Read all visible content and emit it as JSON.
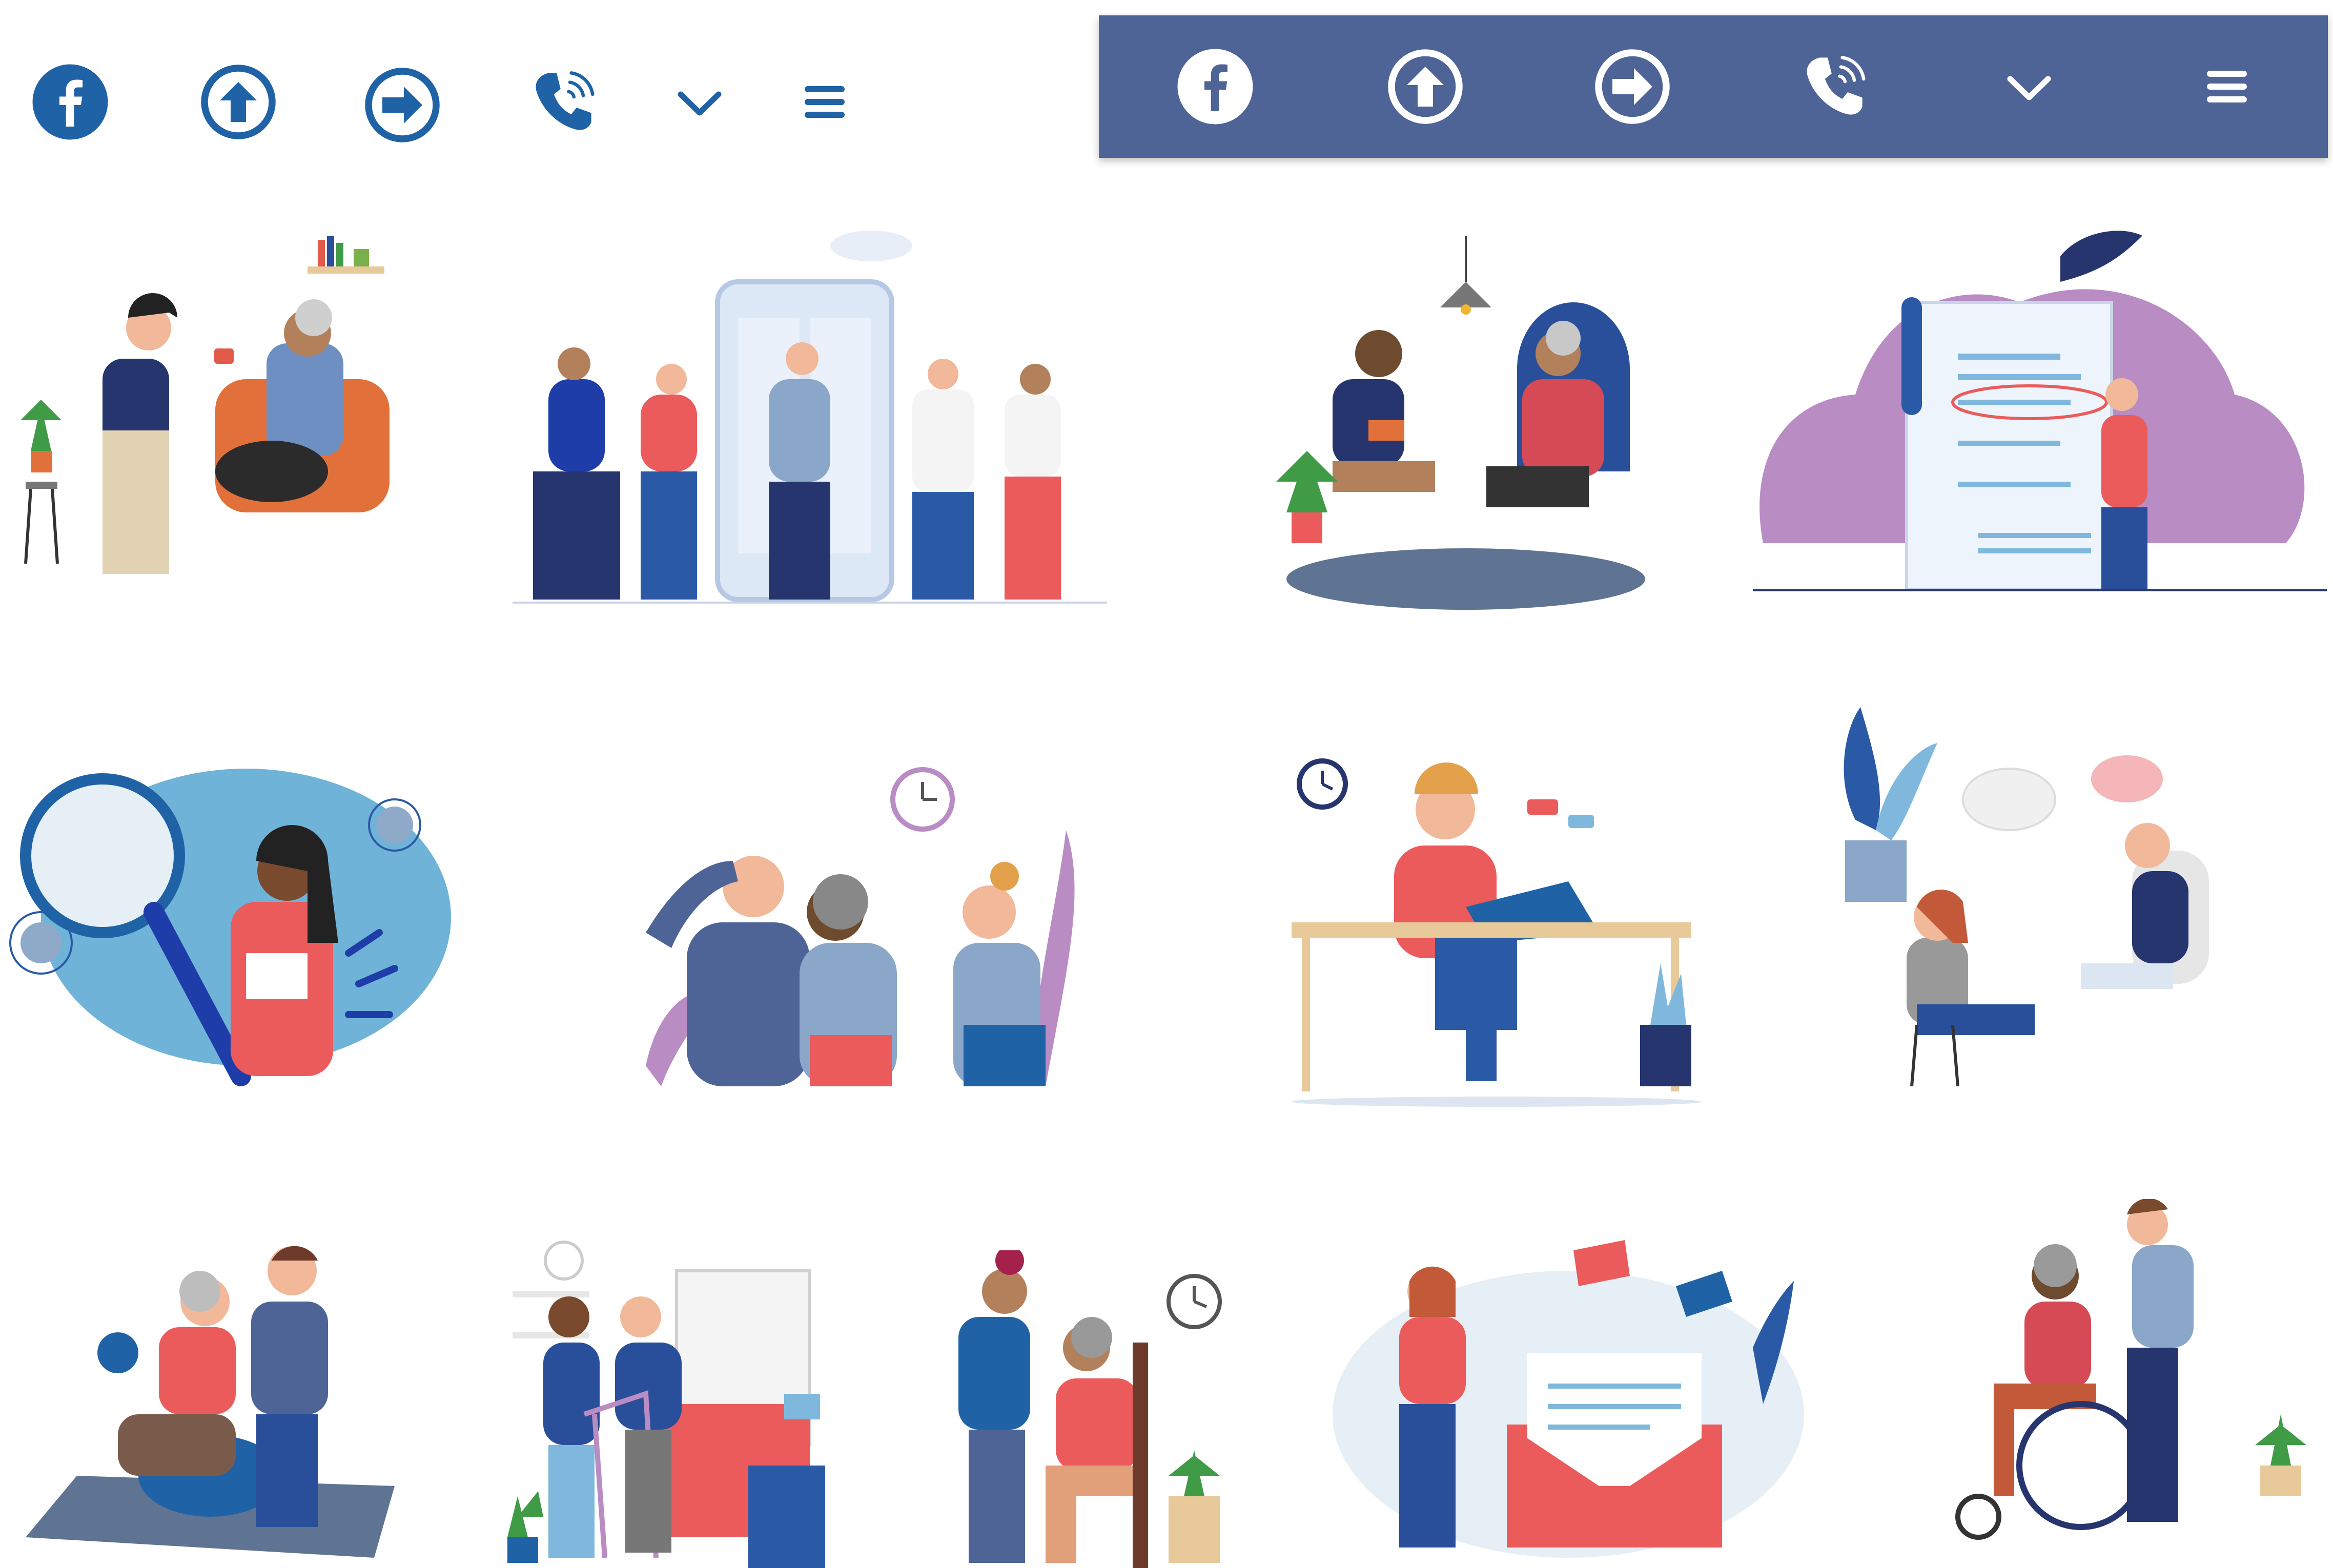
{
  "colors": {
    "brand_blue": "#1f63a6",
    "panel_blue": "#4e6497",
    "white": "#ffffff",
    "coral": "#ec5b5b",
    "navy": "#26356e",
    "purple": "#b98cc4",
    "light_blue": "#7fb8dc",
    "skin": "#f2b89a",
    "orange_chair": "#e2703a",
    "grey": "#8a96a6",
    "plant_green": "#3f9b46"
  },
  "icons_light": {
    "facebook": "facebook-icon",
    "arrow_up": "arrow-up-circle-icon",
    "arrow_right": "arrow-right-circle-icon",
    "phone": "phone-ringing-icon",
    "chevron": "chevron-down-icon",
    "menu": "hamburger-menu-icon"
  },
  "icons_dark": {
    "facebook": "facebook-icon",
    "arrow_up": "arrow-up-circle-icon",
    "arrow_right": "arrow-right-circle-icon",
    "phone": "phone-ringing-icon",
    "chevron": "chevron-down-icon",
    "menu": "hamburger-menu-icon"
  },
  "illustrations": [
    "caregiver-serving-tea-illustration",
    "team-mobile-app-illustration",
    "reading-with-elder-illustration",
    "checklist-document-illustration",
    "magnifier-research-illustration",
    "elders-with-nurse-illustration",
    "remote-work-desk-illustration",
    "counseling-conversation-illustration",
    "physiotherapy-ball-illustration",
    "walker-assistance-illustration",
    "nurse-with-seated-elder-illustration",
    "email-envelope-illustration",
    "wheelchair-assistance-illustration"
  ]
}
